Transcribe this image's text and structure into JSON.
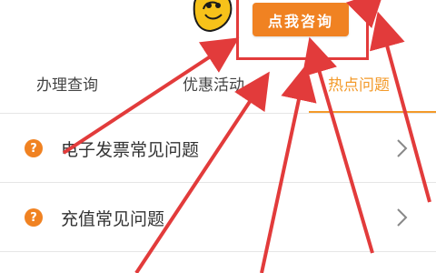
{
  "header": {
    "consult_button_label": "点我咨询"
  },
  "tabs": [
    {
      "label": "办理查询",
      "active": false
    },
    {
      "label": "优惠活动",
      "active": false
    },
    {
      "label": "热点问题",
      "active": true
    }
  ],
  "faq_items": [
    {
      "icon": "question-icon",
      "label": "电子发票常见问题"
    },
    {
      "icon": "question-icon",
      "label": "充值常见问题"
    }
  ],
  "colors": {
    "accent": "#f39a2a",
    "button": "#f08222",
    "annotation_red": "#e23b3b"
  }
}
